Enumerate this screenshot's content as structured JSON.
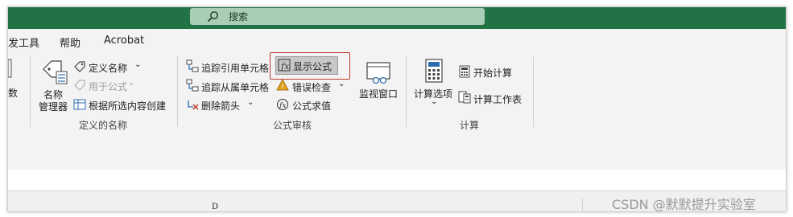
{
  "search": {
    "label": "搜索"
  },
  "tabs": [
    {
      "label": "发工具"
    },
    {
      "label": "帮助"
    },
    {
      "label": "Acrobat"
    }
  ],
  "groups": {
    "defined_names": {
      "partial_label": "数",
      "name_manager": [
        "名称",
        "管理器"
      ],
      "define_name": "定义名称",
      "use_in_formula": "用于公式",
      "create_from_selection": "根据所选内容创建",
      "group_label": "定义的名称"
    },
    "formula_auditing": {
      "trace_precedents": "追踪引用单元格",
      "trace_dependents": "追踪从属单元格",
      "remove_arrows": "删除箭头",
      "show_formulas": "显示公式",
      "error_checking": "错误检查",
      "evaluate_formula": "公式求值",
      "watch_window": "监视窗口",
      "group_label": "公式审核"
    },
    "calculation": {
      "calculation_options": "计算选项",
      "calculate_now": "开始计算",
      "calculate_sheet": "计算工作表",
      "group_label": "计算"
    }
  },
  "sheet": {
    "column_label": "D"
  },
  "watermark": "CSDN @默默提升实验室",
  "colors": {
    "title_bar": "#217346",
    "ribbon_bg": "#f3f3f3",
    "highlight_border": "#c0392b"
  }
}
